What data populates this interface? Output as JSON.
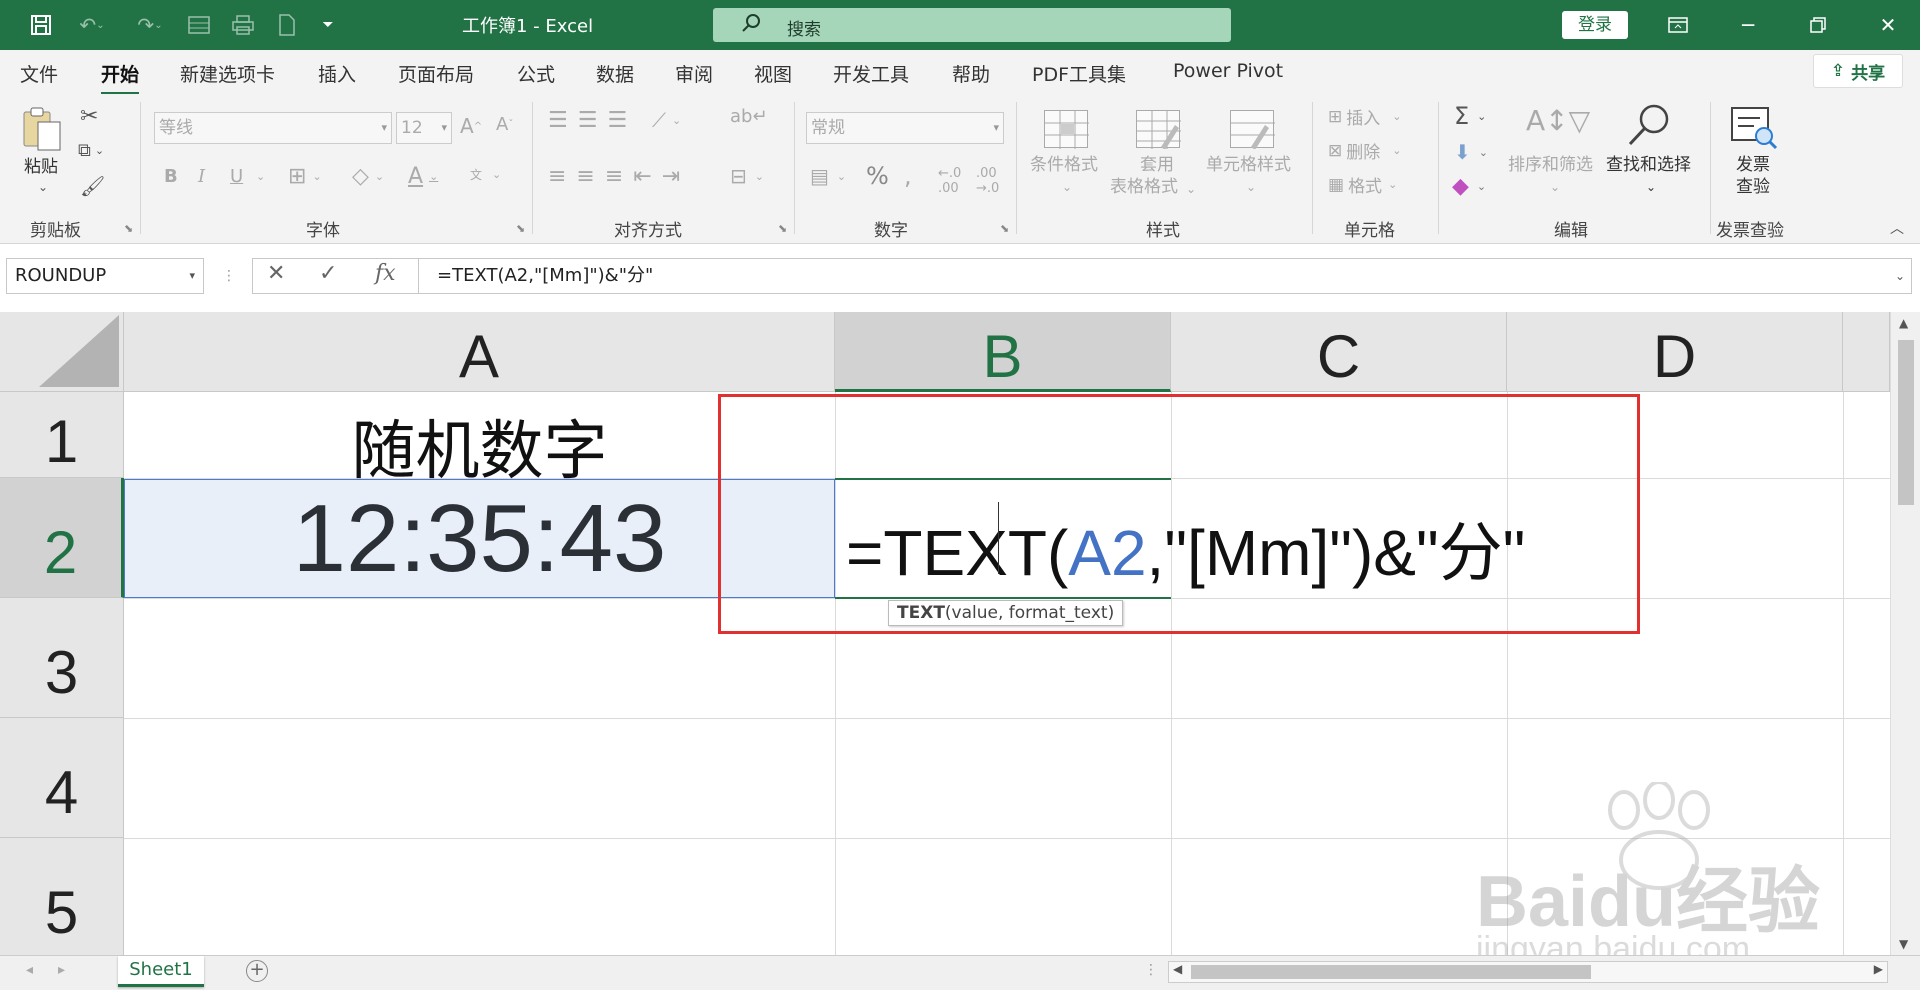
{
  "titlebar": {
    "doc_title": "工作簿1  -  Excel",
    "search_placeholder": "搜索",
    "login_label": "登录"
  },
  "menu": {
    "tabs": [
      "文件",
      "开始",
      "新建选项卡",
      "插入",
      "页面布局",
      "公式",
      "数据",
      "审阅",
      "视图",
      "开发工具",
      "帮助",
      "PDF工具集",
      "Power Pivot"
    ],
    "active": "开始",
    "share_label": "共享"
  },
  "ribbon": {
    "clipboard": {
      "paste_label": "粘贴",
      "group_label": "剪贴板"
    },
    "font": {
      "font_name": "等线",
      "font_size": "12",
      "group_label": "字体",
      "bold": "B",
      "italic": "I",
      "underline": "U"
    },
    "alignment": {
      "group_label": "对齐方式"
    },
    "number": {
      "format": "常规",
      "group_label": "数字",
      "percent": "%"
    },
    "styles": {
      "conditional_format": "条件格式",
      "table_format_line1": "套用",
      "table_format_line2": "表格格式",
      "cell_styles": "单元格样式",
      "group_label": "样式"
    },
    "cells": {
      "insert": "插入",
      "delete": "删除",
      "format": "格式",
      "group_label": "单元格"
    },
    "editing": {
      "sort_filter": "排序和筛选",
      "find_select": "查找和选择",
      "group_label": "编辑"
    },
    "invoice": {
      "check_line1": "发票",
      "check_line2": "查验",
      "group_label": "发票查验"
    }
  },
  "formula_bar": {
    "name_box": "ROUNDUP",
    "formula": "=TEXT(A2,\"[Mm]\")&\"分\""
  },
  "sheet": {
    "columns": [
      "A",
      "B",
      "C",
      "D"
    ],
    "rows": [
      "1",
      "2",
      "3",
      "4",
      "5"
    ],
    "a1": "随机数字",
    "a2": "12:35:43",
    "edit_prefix": "=TEXT(",
    "edit_ref": "A2",
    "edit_suffix": ",\"[Mm]\")&\"分\"",
    "tooltip_func": "TEXT",
    "tooltip_args": "(value, format_text)"
  },
  "sheet_tabs": [
    "Sheet1"
  ],
  "watermark": {
    "brand": "Baidu经验",
    "url": "jingyan.baidu.com"
  },
  "colors": {
    "excel_green": "#217346",
    "highlight_red": "#e03030",
    "ref_blue": "#4472c4"
  }
}
